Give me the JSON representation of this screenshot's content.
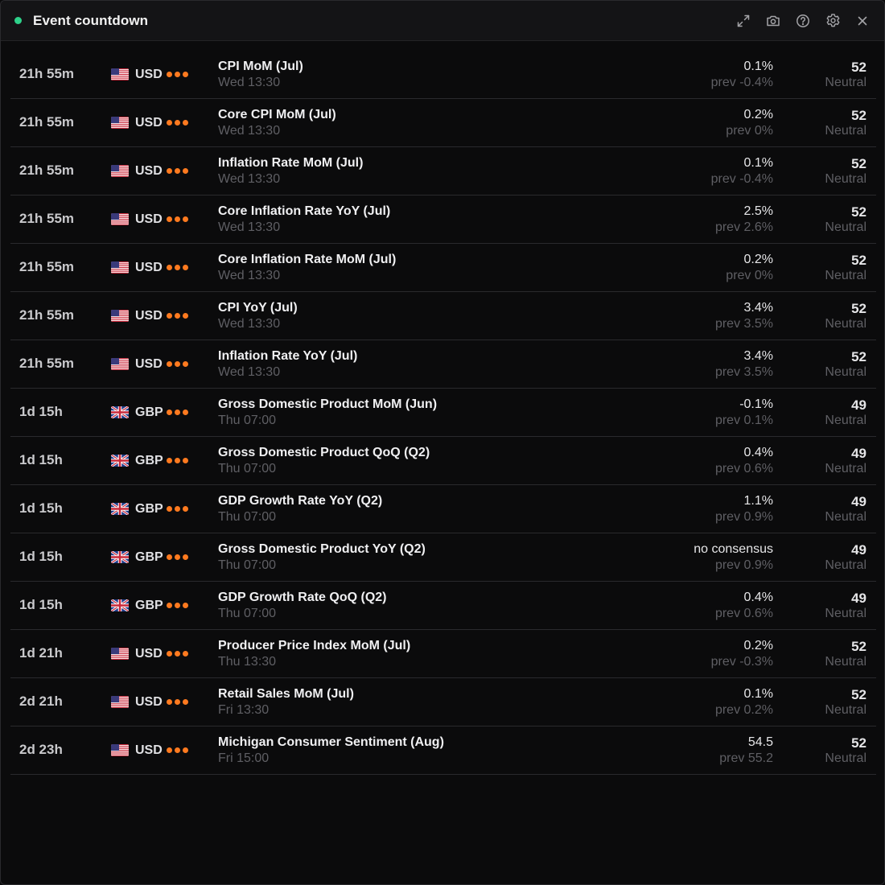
{
  "window": {
    "title": "Event countdown",
    "status_color": "#2ed18a",
    "actions": [
      {
        "name": "expand-icon",
        "label": "expand"
      },
      {
        "name": "camera-icon",
        "label": "screenshot"
      },
      {
        "name": "help-icon",
        "label": "help"
      },
      {
        "name": "gear-icon",
        "label": "settings"
      },
      {
        "name": "close-icon",
        "label": "close"
      }
    ]
  },
  "colors": {
    "importance_dot": "#ff7a1f",
    "accent_dot": "#2ed18a"
  },
  "events": [
    {
      "countdown": "21h 55m",
      "flag": "us",
      "currency": "USD",
      "importance": 3,
      "name": "CPI MoM (Jul)",
      "time": "Wed 13:30",
      "consensus": "0.1%",
      "previous": "prev -0.4%",
      "score": "52",
      "sentiment": "Neutral"
    },
    {
      "countdown": "21h 55m",
      "flag": "us",
      "currency": "USD",
      "importance": 3,
      "name": "Core CPI MoM (Jul)",
      "time": "Wed 13:30",
      "consensus": "0.2%",
      "previous": "prev 0%",
      "score": "52",
      "sentiment": "Neutral"
    },
    {
      "countdown": "21h 55m",
      "flag": "us",
      "currency": "USD",
      "importance": 3,
      "name": "Inflation Rate MoM (Jul)",
      "time": "Wed 13:30",
      "consensus": "0.1%",
      "previous": "prev -0.4%",
      "score": "52",
      "sentiment": "Neutral"
    },
    {
      "countdown": "21h 55m",
      "flag": "us",
      "currency": "USD",
      "importance": 3,
      "name": "Core Inflation Rate YoY (Jul)",
      "time": "Wed 13:30",
      "consensus": "2.5%",
      "previous": "prev 2.6%",
      "score": "52",
      "sentiment": "Neutral"
    },
    {
      "countdown": "21h 55m",
      "flag": "us",
      "currency": "USD",
      "importance": 3,
      "name": "Core Inflation Rate MoM (Jul)",
      "time": "Wed 13:30",
      "consensus": "0.2%",
      "previous": "prev 0%",
      "score": "52",
      "sentiment": "Neutral"
    },
    {
      "countdown": "21h 55m",
      "flag": "us",
      "currency": "USD",
      "importance": 3,
      "name": "CPI YoY (Jul)",
      "time": "Wed 13:30",
      "consensus": "3.4%",
      "previous": "prev 3.5%",
      "score": "52",
      "sentiment": "Neutral"
    },
    {
      "countdown": "21h 55m",
      "flag": "us",
      "currency": "USD",
      "importance": 3,
      "name": "Inflation Rate YoY (Jul)",
      "time": "Wed 13:30",
      "consensus": "3.4%",
      "previous": "prev 3.5%",
      "score": "52",
      "sentiment": "Neutral"
    },
    {
      "countdown": "1d 15h",
      "flag": "gb",
      "currency": "GBP",
      "importance": 3,
      "name": "Gross Domestic Product MoM (Jun)",
      "time": "Thu 07:00",
      "consensus": "-0.1%",
      "previous": "prev 0.1%",
      "score": "49",
      "sentiment": "Neutral"
    },
    {
      "countdown": "1d 15h",
      "flag": "gb",
      "currency": "GBP",
      "importance": 3,
      "name": "Gross Domestic Product QoQ (Q2)",
      "time": "Thu 07:00",
      "consensus": "0.4%",
      "previous": "prev 0.6%",
      "score": "49",
      "sentiment": "Neutral"
    },
    {
      "countdown": "1d 15h",
      "flag": "gb",
      "currency": "GBP",
      "importance": 3,
      "name": "GDP Growth Rate YoY (Q2)",
      "time": "Thu 07:00",
      "consensus": "1.1%",
      "previous": "prev 0.9%",
      "score": "49",
      "sentiment": "Neutral"
    },
    {
      "countdown": "1d 15h",
      "flag": "gb",
      "currency": "GBP",
      "importance": 3,
      "name": "Gross Domestic Product YoY (Q2)",
      "time": "Thu 07:00",
      "consensus": "no consensus",
      "previous": "prev 0.9%",
      "score": "49",
      "sentiment": "Neutral"
    },
    {
      "countdown": "1d 15h",
      "flag": "gb",
      "currency": "GBP",
      "importance": 3,
      "name": "GDP Growth Rate QoQ (Q2)",
      "time": "Thu 07:00",
      "consensus": "0.4%",
      "previous": "prev 0.6%",
      "score": "49",
      "sentiment": "Neutral"
    },
    {
      "countdown": "1d 21h",
      "flag": "us",
      "currency": "USD",
      "importance": 3,
      "name": "Producer Price Index MoM (Jul)",
      "time": "Thu 13:30",
      "consensus": "0.2%",
      "previous": "prev -0.3%",
      "score": "52",
      "sentiment": "Neutral"
    },
    {
      "countdown": "2d 21h",
      "flag": "us",
      "currency": "USD",
      "importance": 3,
      "name": "Retail Sales MoM (Jul)",
      "time": "Fri 13:30",
      "consensus": "0.1%",
      "previous": "prev 0.2%",
      "score": "52",
      "sentiment": "Neutral"
    },
    {
      "countdown": "2d 23h",
      "flag": "us",
      "currency": "USD",
      "importance": 3,
      "name": "Michigan Consumer Sentiment (Aug)",
      "time": "Fri 15:00",
      "consensus": "54.5",
      "previous": "prev 55.2",
      "score": "52",
      "sentiment": "Neutral"
    }
  ]
}
